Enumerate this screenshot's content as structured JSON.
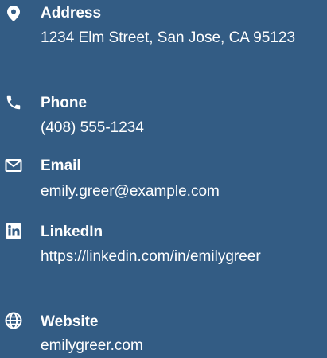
{
  "contact": {
    "address": {
      "label": "Address",
      "value": "1234 Elm Street, San Jose, CA 95123",
      "icon": "location-pin-icon"
    },
    "phone": {
      "label": "Phone",
      "value": "(408) 555-1234",
      "icon": "phone-icon"
    },
    "email": {
      "label": "Email",
      "value": "emily.greer@example.com",
      "icon": "envelope-icon"
    },
    "linkedin": {
      "label": "LinkedIn",
      "value": "https://linkedin.com/in/emilygreer",
      "icon": "linkedin-icon"
    },
    "website": {
      "label": "Website",
      "value": "emilygreer.com",
      "icon": "globe-icon"
    }
  },
  "colors": {
    "background": "#335c84",
    "text": "#ffffff"
  }
}
